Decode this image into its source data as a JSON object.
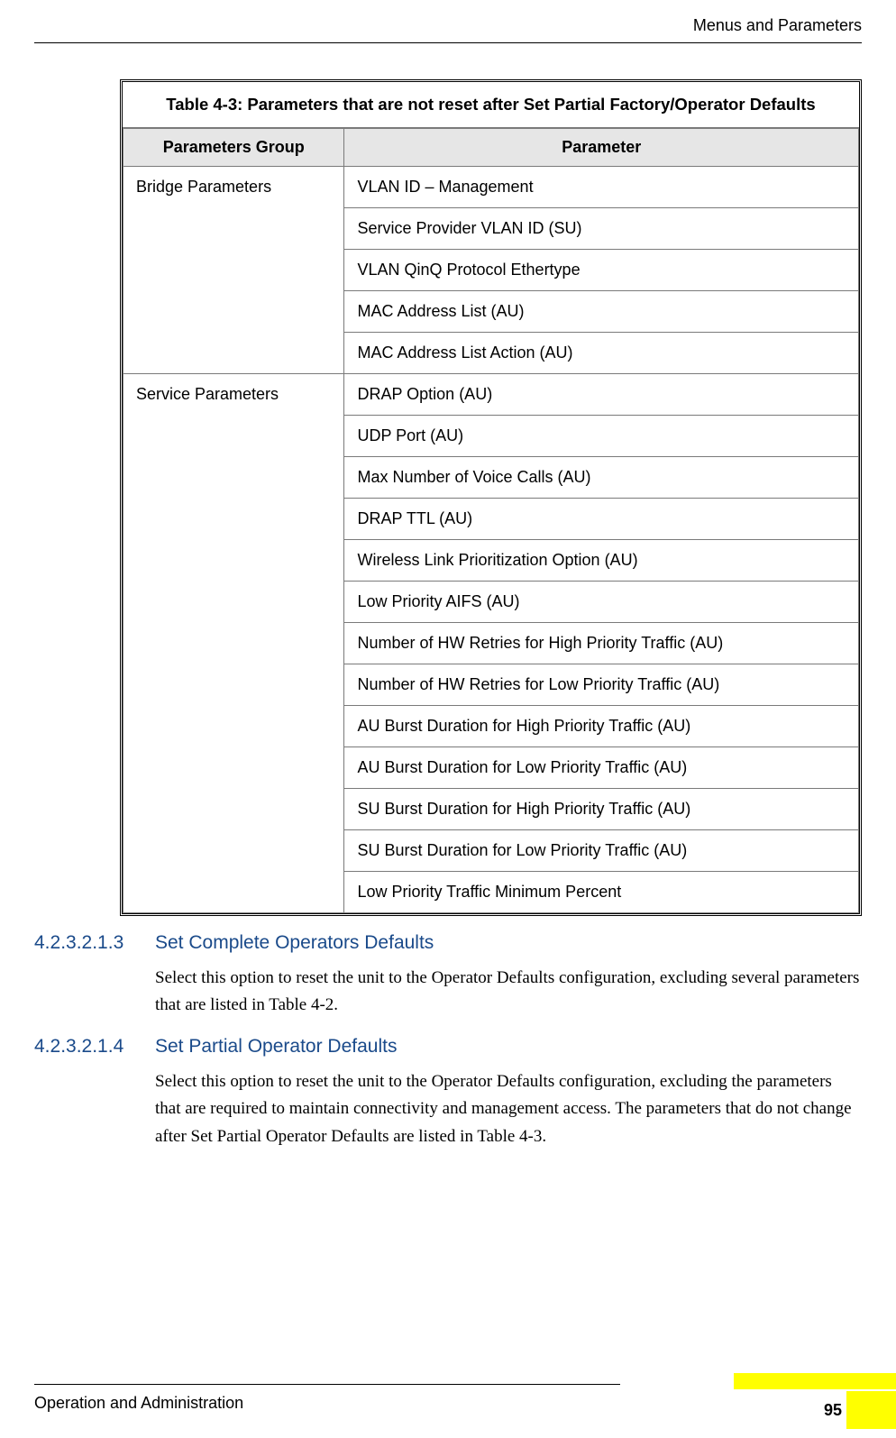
{
  "header": {
    "right": "Menus and Parameters"
  },
  "table": {
    "caption": "Table 4-3: Parameters that are not reset after Set Partial Factory/Operator Defaults",
    "headers": {
      "col1": "Parameters Group",
      "col2": "Parameter"
    },
    "groups": [
      {
        "name": "Bridge Parameters",
        "params": [
          "VLAN ID – Management",
          "Service Provider VLAN ID (SU)",
          "VLAN QinQ Protocol Ethertype",
          "MAC Address List (AU)",
          "MAC Address List Action (AU)"
        ]
      },
      {
        "name": "Service Parameters",
        "params": [
          "DRAP Option (AU)",
          "UDP Port (AU)",
          "Max Number of Voice Calls (AU)",
          "DRAP TTL (AU)",
          "Wireless Link Prioritization Option (AU)",
          "Low Priority AIFS (AU)",
          "Number of HW Retries for High Priority Traffic (AU)",
          "Number of HW Retries for Low Priority Traffic (AU)",
          "AU Burst Duration for High Priority Traffic (AU)",
          "AU Burst Duration for Low Priority Traffic (AU)",
          "SU Burst Duration for High Priority Traffic (AU)",
          "SU Burst Duration for Low Priority Traffic (AU)",
          "Low Priority Traffic Minimum Percent"
        ]
      }
    ]
  },
  "sections": [
    {
      "num": "4.2.3.2.1.3",
      "title": "Set Complete Operators Defaults",
      "body": "Select this option to reset the unit to the Operator Defaults configuration, excluding several parameters that are listed in Table 4-2."
    },
    {
      "num": "4.2.3.2.1.4",
      "title": "Set Partial Operator Defaults",
      "body": "Select this option to reset the unit to the Operator Defaults configuration, excluding the parameters that are required to maintain connectivity and management access. The parameters that do not change after Set Partial Operator Defaults are listed in Table 4-3."
    }
  ],
  "footer": {
    "left": "Operation and Administration",
    "page": "95"
  }
}
